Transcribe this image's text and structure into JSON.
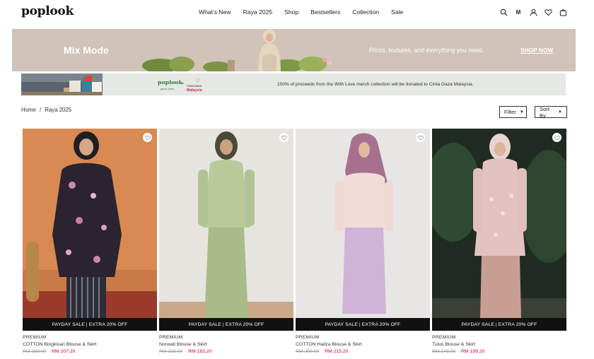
{
  "brand": {
    "logo": "poplook"
  },
  "nav": [
    "What's New",
    "Raya 2025",
    "Shop",
    "Bestsellers",
    "Collection",
    "Sale"
  ],
  "header_icons": {
    "search": "search-icon",
    "lang": "M",
    "account": "user-icon",
    "wishlist": "heart-icon",
    "cart": "bag-icon"
  },
  "hero": {
    "title": "Mix Mode",
    "subtitle": "Prints, textures, and everything you need.",
    "cta": "SHOP NOW",
    "bg_color": "#d1c3b8"
  },
  "promo": {
    "logo": "poplook",
    "logo_sub": "gives back",
    "plus": "+",
    "partner_line1": "Cinta Gaza",
    "partner_line2": "Malaysia",
    "text": "100% of proceeds from the With Love merch collection will be donated to Cinta Gaza Malaysia."
  },
  "breadcrumb": [
    "Home",
    "/",
    "Raya 2025"
  ],
  "controls": {
    "filter": "Filter",
    "sort": "Sort By"
  },
  "products": [
    {
      "badge": "PAYDAY SALE | EXTRA 20% OFF",
      "tag": "PREMIUM",
      "name": "COTTON Bingkisan Blouse & Skirt",
      "old_price": "RM 259.00",
      "price": "RM 207.20"
    },
    {
      "badge": "PAYDAY SALE | EXTRA 20% OFF",
      "tag": "PREMIUM",
      "name": "Norwati Blouse & Skirt",
      "old_price": "RM 229.00",
      "price": "RM 183.20"
    },
    {
      "badge": "PAYDAY SALE | EXTRA 20% OFF",
      "tag": "PREMIUM",
      "name": "COTTON Hailza Blouse & Skirt",
      "old_price": "RM 269.00",
      "price": "RM 215.20"
    },
    {
      "badge": "PAYDAY SALE | EXTRA 20% OFF",
      "tag": "PREMIUM",
      "name": "Tulus Blouse & Skirt",
      "old_price": "RM 249.00",
      "price": "RM 199.20"
    }
  ],
  "colors": {
    "sale_price": "#d0021b",
    "badge_bg": "#111111"
  }
}
